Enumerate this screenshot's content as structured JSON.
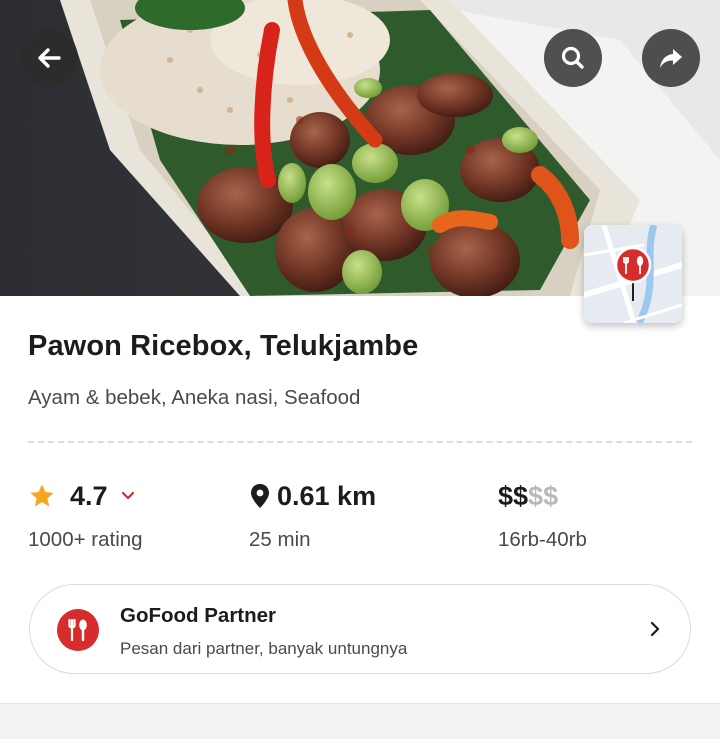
{
  "restaurant": {
    "name": "Pawon Ricebox, Telukjambe",
    "cuisines": "Ayam & bebek, Aneka nasi, Seafood"
  },
  "stats": {
    "rating": {
      "value": "4.7",
      "label": "1000+ rating"
    },
    "distance": {
      "value": "0.61 km",
      "label": "25 min"
    },
    "price": {
      "active": "$$",
      "inactive": "$$",
      "label": "16rb-40rb"
    }
  },
  "partner": {
    "title": "GoFood Partner",
    "subtitle": "Pesan dari partner, banyak untungnya"
  },
  "icons": {
    "back": "arrow-left-icon",
    "search": "search-icon",
    "share": "share-icon",
    "map": "map-pin-icon",
    "star": "star-icon",
    "location": "location-pin-icon",
    "partner": "fork-spoon-icon",
    "chevron": "chevron-right-icon"
  },
  "colors": {
    "brand_red": "#d62c2c",
    "star_yellow": "#f5a623",
    "text_primary": "#1c1c1c",
    "text_secondary": "#4a4a4a",
    "price_inactive": "#b9b9b9"
  }
}
